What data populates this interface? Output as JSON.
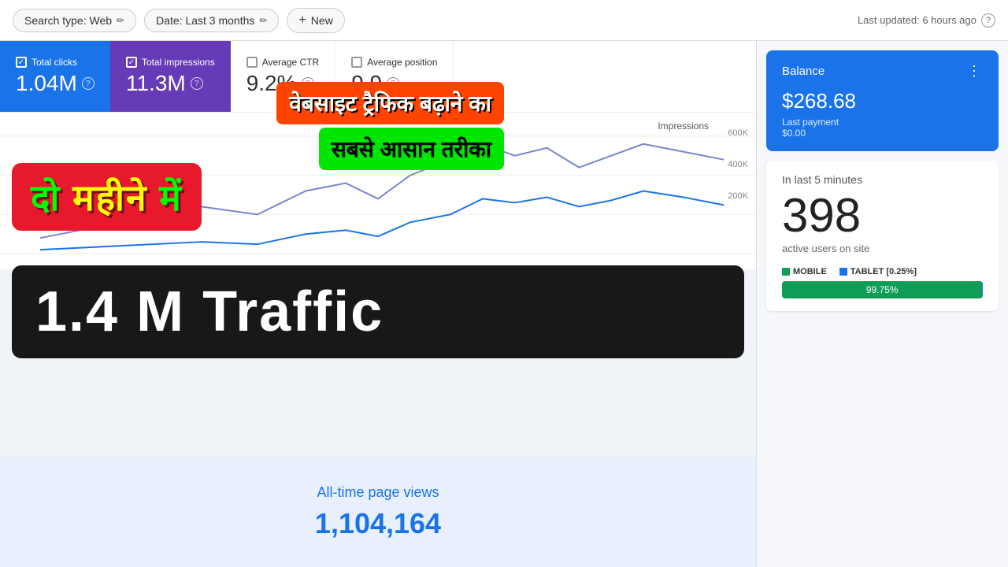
{
  "toolbar": {
    "search_type_label": "Search type: Web",
    "date_label": "Date: Last 3 months",
    "new_label": "New",
    "last_updated": "Last updated: 6 hours ago"
  },
  "metrics": {
    "total_clicks": {
      "label": "Total clicks",
      "value": "1.04M"
    },
    "total_impressions": {
      "label": "Total impressions",
      "value": "11.3M"
    },
    "average_ctr": {
      "label": "Average CTR",
      "value": "9.2%"
    },
    "average_position": {
      "label": "Average position",
      "value": "9.9"
    }
  },
  "chart": {
    "y_labels": [
      "600K",
      "400K",
      "200K"
    ],
    "label": "Impressions"
  },
  "overlays": {
    "banner1_line1": "वेबसाइट ट्रैफिक बढ़ाने का",
    "banner2_line1": "सबसे आसान तरीका",
    "banner3": "दो महीने में",
    "banner4": "1.4 M Traffic"
  },
  "pageviews": {
    "label": "All-time page views",
    "value": "1,104,164"
  },
  "balance": {
    "title": "Balance",
    "amount": "$268.68",
    "last_payment_label": "Last payment",
    "last_payment_value": "$0.00"
  },
  "realtime": {
    "period_label": "In last 5 minutes",
    "count": "398",
    "sublabel": "active users on site",
    "mobile_label": "MOBILE",
    "tablet_label": "TABLET [0.25%]",
    "mobile_percent": "99.75%",
    "mobile_bar_width": "99.75",
    "tablet_bar_width": "0.25"
  }
}
